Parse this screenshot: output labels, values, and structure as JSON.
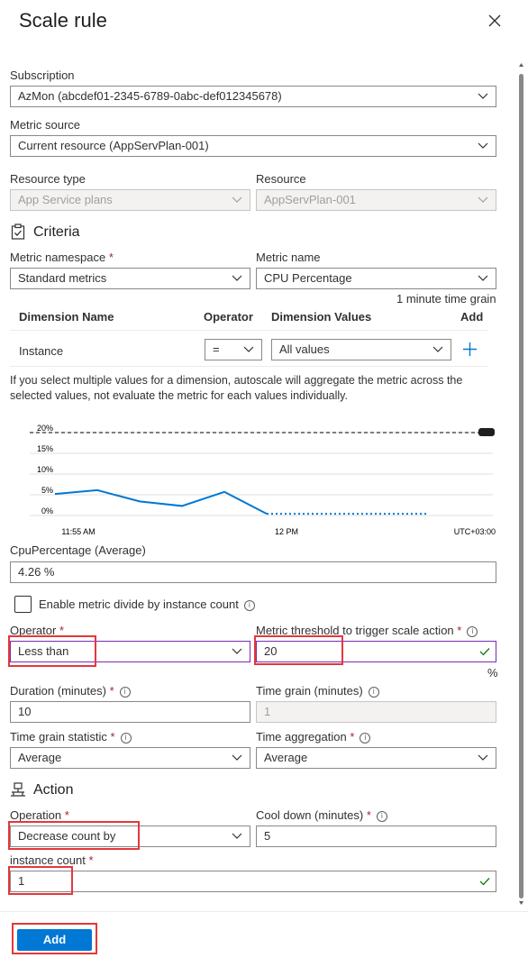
{
  "header": {
    "title": "Scale rule"
  },
  "subscription": {
    "label": "Subscription",
    "value": "AzMon (abcdef01-2345-6789-0abc-def012345678)"
  },
  "metric_source": {
    "label": "Metric source",
    "value": "Current resource (AppServPlan-001)"
  },
  "resource_type": {
    "label": "Resource type",
    "value": "App Service plans"
  },
  "resource": {
    "label": "Resource",
    "value": "AppServPlan-001"
  },
  "criteria": {
    "title": "Criteria"
  },
  "metric_namespace": {
    "label": "Metric namespace",
    "required": "*",
    "value": "Standard metrics"
  },
  "metric_name": {
    "label": "Metric name",
    "value": "CPU Percentage",
    "time_grain_note": "1 minute time grain"
  },
  "dimension_table": {
    "headers": {
      "name": "Dimension Name",
      "operator": "Operator",
      "values": "Dimension Values",
      "add": "Add"
    },
    "row": {
      "name": "Instance",
      "operator": "=",
      "values": "All values"
    }
  },
  "dimension_note": "If you select multiple values for a dimension, autoscale will aggregate the metric across the selected values, not evaluate the metric for each values individually.",
  "chart_data": {
    "type": "line",
    "y_ticks": [
      "20%",
      "15%",
      "10%",
      "5%",
      "0%"
    ],
    "x_ticks": [
      "11:55 AM",
      "12 PM"
    ],
    "timezone": "UTC+03:00",
    "ylim": [
      0,
      20
    ],
    "threshold": 20,
    "series": [
      {
        "values": [
          5.2,
          6.1,
          3.4,
          2.3,
          5.7,
          0.4
        ],
        "style": "solid",
        "color": "#0078d4"
      },
      {
        "values": [
          0.4,
          0.4,
          0.4,
          0.4
        ],
        "style": "dotted",
        "color": "#0078d4"
      }
    ]
  },
  "metric_summary": {
    "label": "CpuPercentage (Average)",
    "value": "4.26 %"
  },
  "enable_divide": {
    "label": "Enable metric divide by instance count"
  },
  "operator": {
    "label": "Operator",
    "value": "Less than"
  },
  "threshold": {
    "label": "Metric threshold to trigger scale action",
    "value": "20",
    "unit": "%"
  },
  "duration": {
    "label": "Duration (minutes)",
    "value": "10"
  },
  "time_grain": {
    "label": "Time grain (minutes)",
    "value": "1"
  },
  "time_grain_statistic": {
    "label": "Time grain statistic",
    "value": "Average"
  },
  "time_aggregation": {
    "label": "Time aggregation",
    "value": "Average"
  },
  "action": {
    "title": "Action"
  },
  "operation": {
    "label": "Operation",
    "value": "Decrease count by"
  },
  "cool_down": {
    "label": "Cool down (minutes)",
    "value": "5"
  },
  "instance_count": {
    "label": "instance count",
    "value": "1"
  },
  "footer": {
    "add_label": "Add"
  },
  "colors": {
    "accent": "#0078d4",
    "required": "#a4262c",
    "highlight": "#e3383b",
    "valid": "#107c10"
  },
  "icons": [
    "close-icon",
    "clipboard-check-icon",
    "chevron-down-icon",
    "plus-icon",
    "info-icon",
    "checkmark-icon",
    "action-icon"
  ]
}
